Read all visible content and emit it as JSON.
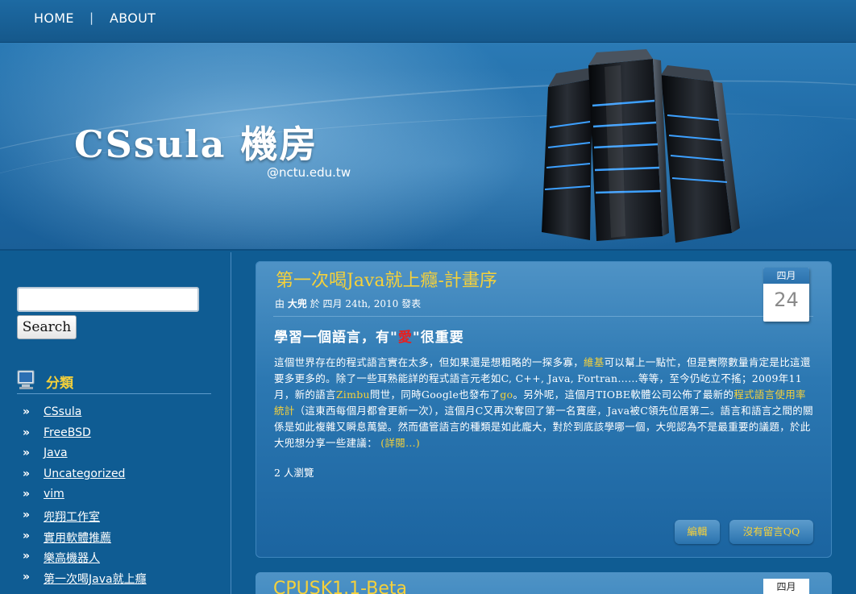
{
  "nav": {
    "home": "HOME",
    "separator": "|",
    "about": "ABOUT"
  },
  "header": {
    "title": "CSsula 機房",
    "subtitle": "@nctu.edu.tw"
  },
  "sidebar": {
    "search_placeholder": "",
    "search_button": "Search",
    "categories_heading": "分類",
    "categories": [
      "CSsula",
      "FreeBSD",
      "Java",
      "Uncategorized",
      "vim",
      "兜翔工作室",
      "實用軟體推薦",
      "樂高機器人",
      "第一次喝Java就上癮"
    ]
  },
  "post": {
    "title": "第一次喝Java就上癮-計畫序",
    "meta_prefix": "由",
    "author": "大兜",
    "meta_mid": "於 四月 24th, 2010 發表",
    "date_month": "四月",
    "date_day": "24",
    "subhead_before": "學習一個語言，有\"",
    "subhead_love": "愛",
    "subhead_after": "\"很重要",
    "body_1": "這個世界存在的程式語言實在太多，但如果還是想粗略的一探多寡，",
    "body_link_wiki": "維基",
    "body_2": "可以幫上一點忙，但是實際數量肯定是比這還要多更多的。除了一些耳熟能詳的程式語言元老如C, C++, Java, Fortran……等等，至今仍屹立不搖；2009年11月，新的語言",
    "body_link_zimbu": "Zimbu",
    "body_3": "問世，同時Google也發布了",
    "body_link_go": "go",
    "body_4": "。另外呢，這個月TIOBE軟體公司公佈了最新的",
    "body_link_stats": "程式語言使用率統計",
    "body_5": "（這東西每個月都會更新一次），這個月C又再次奪回了第一名寶座，Java被C領先位居第二。語言和語言之間的關係是如此複雜又瞬息萬變。然而儘管語言的種類是如此龐大，對於到底該學哪一個，大兜認為不是最重要的議題，於此大兜想分享一些建議：",
    "body_more": "(詳閱...)",
    "views": "2 人瀏覽",
    "edit_button": "編輯",
    "comments_button": "沒有留言QQ"
  },
  "post2": {
    "title": "CPUSK1.1-Beta",
    "date_month": "四月"
  },
  "colors": {
    "accent": "#f6d13a",
    "background": "#0f5c93",
    "love": "#e81e1e"
  }
}
